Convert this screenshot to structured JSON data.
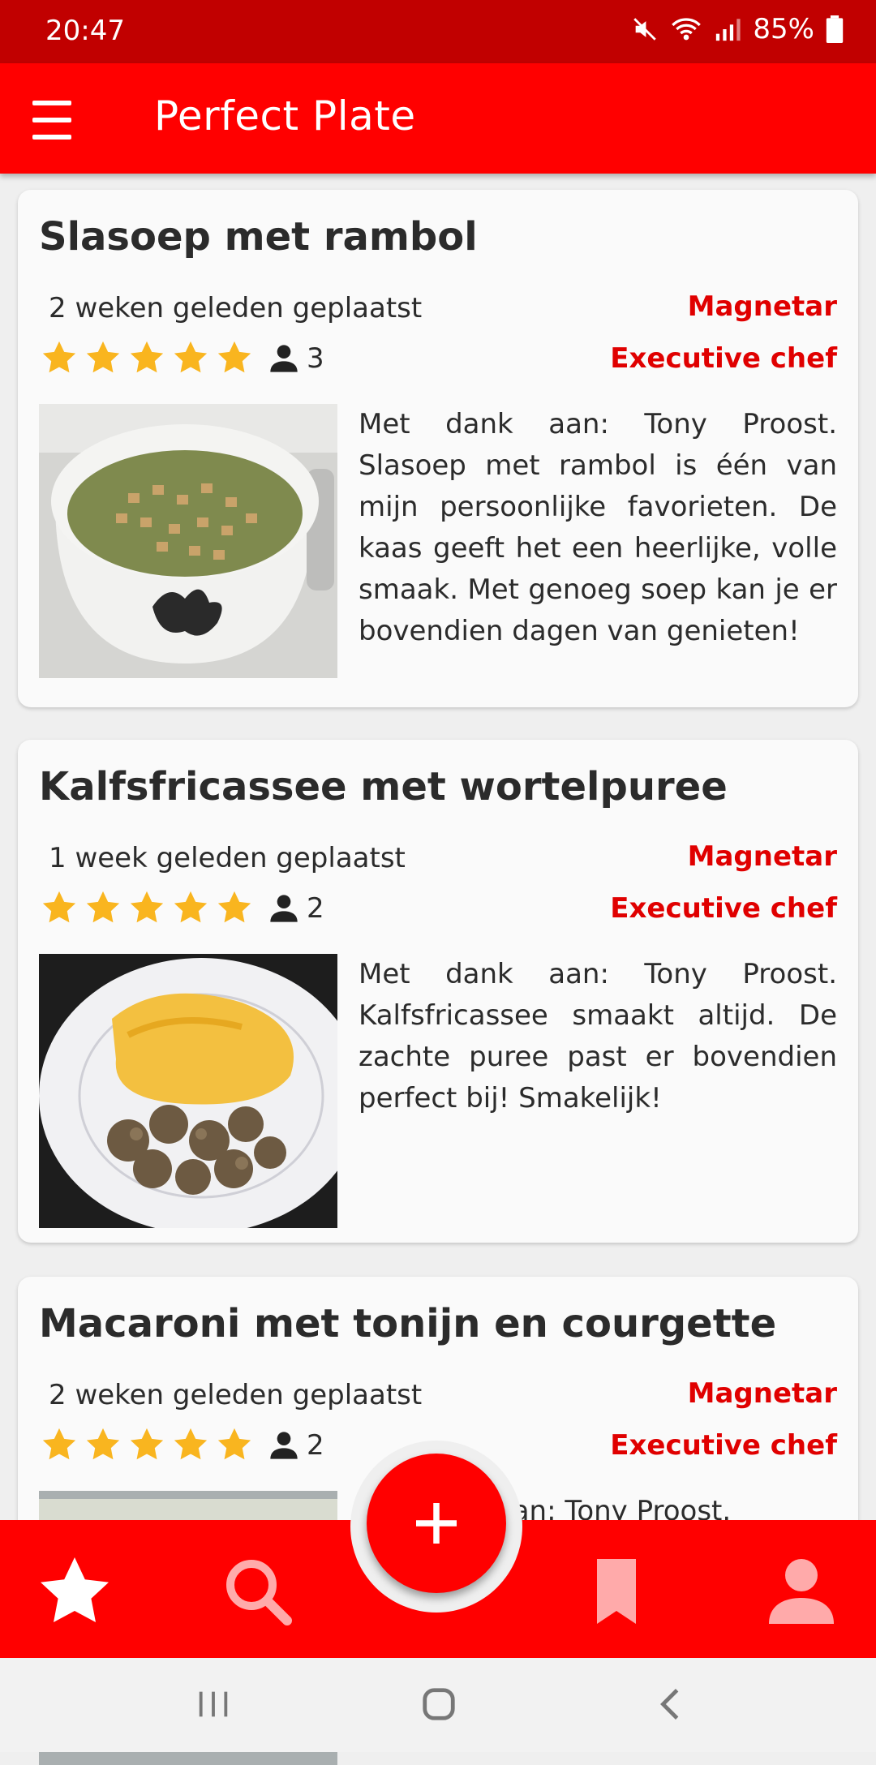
{
  "status_bar": {
    "time": "20:47",
    "battery": "85%"
  },
  "app_bar": {
    "title": "Perfect Plate"
  },
  "recipes": [
    {
      "title": "Slasoep met rambol",
      "posted": "2 weken geleden geplaatst",
      "author": "Magnetar",
      "rank": "Executive chef",
      "rating": 5,
      "reviewers": "3",
      "description": "Met dank aan: Tony Proost. Slasoep met rambol is één van mijn persoonlijke favorieten. De kaas geeft het een heerlijke, volle smaak. Met genoeg soep kan je er bovendien dagen van genieten!"
    },
    {
      "title": "Kalfsfricassee met wortelpuree",
      "posted": "1 week geleden geplaatst",
      "author": "Magnetar",
      "rank": "Executive chef",
      "rating": 5,
      "reviewers": "2",
      "description": "Met dank aan: Tony Proost. Kalfsfricassee smaakt altijd. De zachte puree past er bovendien perfect bij! Smakelijk!"
    },
    {
      "title": "Macaroni met tonijn en courgette",
      "posted": "2 weken geleden geplaatst",
      "author": "Magnetar",
      "rank": "Executive chef",
      "rating": 5,
      "reviewers": "2",
      "description": "Met dank aan: Tony Proost."
    }
  ],
  "bottom_nav": [
    "star-icon",
    "search-icon",
    "bookmark-icon",
    "person-icon"
  ],
  "colors": {
    "primary": "#ff0000",
    "status_bar": "#c10000",
    "accent_text": "#e00000",
    "star": "#f9b51f"
  }
}
